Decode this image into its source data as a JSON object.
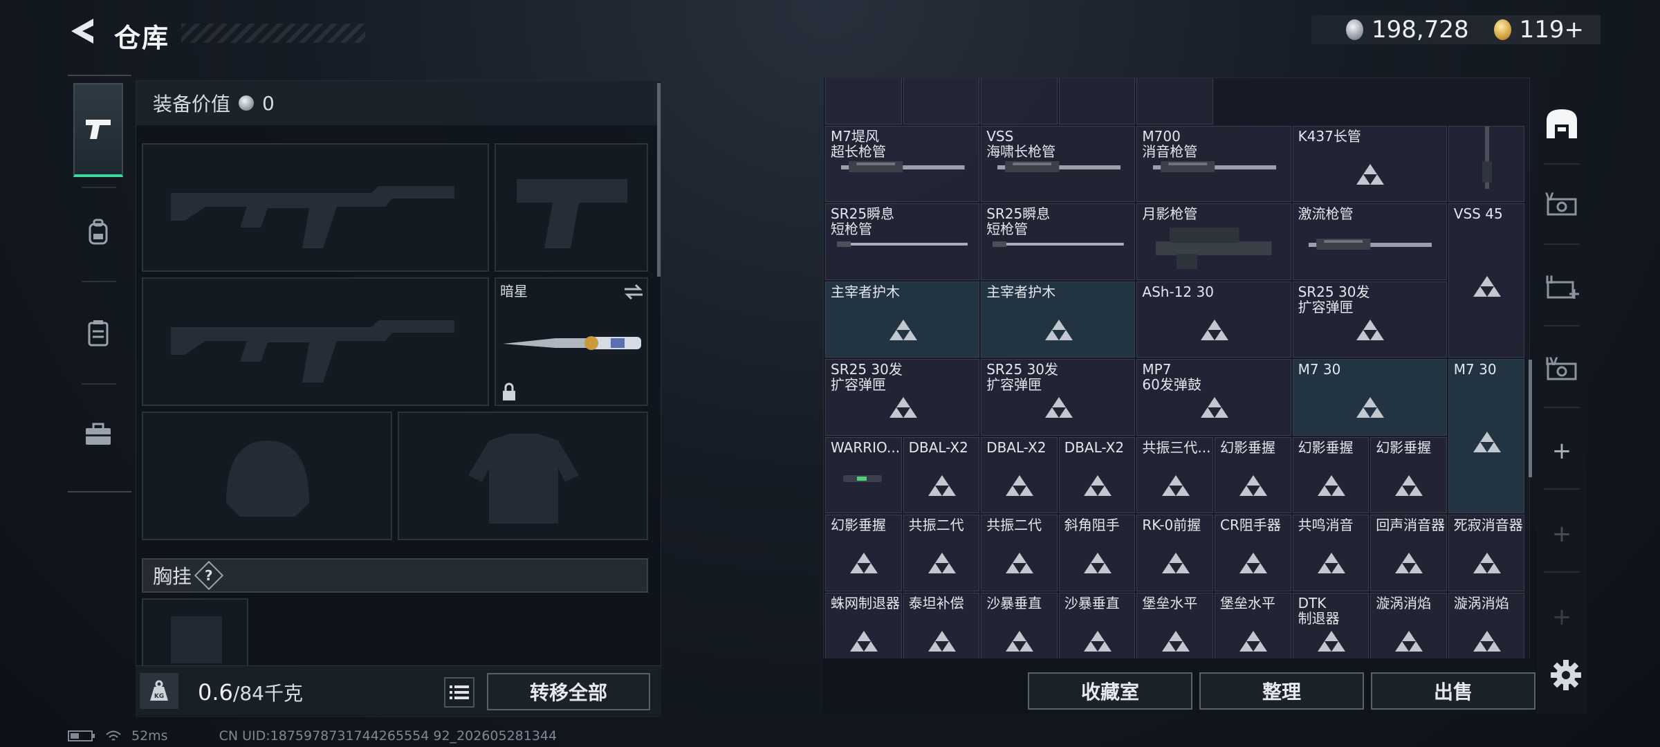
{
  "header": {
    "title": "仓库",
    "back_icon": "back-arrow-icon",
    "currencies": [
      {
        "name": "silver-coin",
        "value": "198,728",
        "color": "#c7ccd3"
      },
      {
        "name": "gold-coin",
        "value": "119+",
        "color": "#d9a53a"
      }
    ]
  },
  "left_tabs": [
    {
      "icon": "pistol-icon",
      "active": true
    },
    {
      "icon": "backpack-icon",
      "active": false
    },
    {
      "icon": "vest-icon",
      "active": false
    },
    {
      "icon": "toolbox-icon",
      "active": false
    }
  ],
  "loadout": {
    "equip_value_label": "装备价值",
    "equip_value": "0",
    "slots": [
      {
        "name": "primary-weapon-1",
        "content": "rifle-silhouette"
      },
      {
        "name": "pistol",
        "content": "pistol-silhouette"
      },
      {
        "name": "primary-weapon-2",
        "content": "rifle-silhouette"
      },
      {
        "name": "melee",
        "item_name": "暗星",
        "locked": true
      },
      {
        "name": "helmet",
        "content": "helmet-silhouette"
      },
      {
        "name": "body-armor",
        "content": "armor-silhouette"
      }
    ],
    "chest_rig_label": "胸挂",
    "chest_rig_help": "?",
    "weight_current": "0.6",
    "weight_max": "/84千克",
    "kg_icon": "weight-kg-icon",
    "transfer_all_label": "转移全部"
  },
  "inventory": {
    "rows": [
      [
        {
          "label": "",
          "w": 1,
          "art": "weapon-part"
        },
        {
          "label": "",
          "w": 1,
          "art": "weapon-part"
        },
        {
          "label": "",
          "w": 1,
          "art": "weapon-part"
        },
        {
          "label": "",
          "w": 1,
          "art": "weapon-part"
        },
        {
          "label": "",
          "w": 1,
          "art": "weapon-part"
        }
      ],
      [
        {
          "label": "M7堤风\n超长枪管",
          "w": 2,
          "art": "barrel"
        },
        {
          "label": "VSS\n海啸长枪管",
          "w": 2,
          "art": "barrel"
        },
        {
          "label": "M700\n消音枪管",
          "w": 2,
          "art": "barrel"
        },
        {
          "label": "K437长管",
          "w": 2,
          "art": "placeholder"
        },
        {
          "label": "",
          "w": 1,
          "art": "vertical-barrel"
        }
      ],
      [
        {
          "label": "SR25瞬息\n短枪管",
          "w": 2,
          "art": "thin-barrel"
        },
        {
          "label": "SR25瞬息\n短枪管",
          "w": 2,
          "art": "thin-barrel"
        },
        {
          "label": "月影枪管",
          "w": 2,
          "art": "scope-barrel"
        },
        {
          "label": "激流枪管",
          "w": 2,
          "art": "barrel"
        },
        {
          "label": "VSS 45",
          "w": 1,
          "art": "placeholder",
          "h": 2
        }
      ],
      [
        {
          "label": "主宰者护木",
          "w": 2,
          "art": "placeholder",
          "teal": true
        },
        {
          "label": "主宰者护木",
          "w": 2,
          "art": "placeholder",
          "teal": true
        },
        {
          "label": "ASh-12 30",
          "w": 2,
          "art": "placeholder"
        },
        {
          "label": "SR25 30发\n扩容弹匣",
          "w": 2,
          "art": "placeholder"
        }
      ],
      [
        {
          "label": "SR25 30发\n扩容弹匣",
          "w": 2,
          "art": "placeholder"
        },
        {
          "label": "SR25 30发\n扩容弹匣",
          "w": 2,
          "art": "placeholder"
        },
        {
          "label": "MP7\n60发弹鼓",
          "w": 2,
          "art": "placeholder"
        },
        {
          "label": "M7 30",
          "w": 2,
          "art": "placeholder",
          "teal": true
        },
        {
          "label": "M7 30",
          "w": 1,
          "art": "placeholder",
          "teal": true,
          "h": 2
        }
      ],
      [
        {
          "label": "WARRIO...",
          "w": 1,
          "art": "flashlight"
        },
        {
          "label": "DBAL-X2",
          "w": 1,
          "art": "placeholder"
        },
        {
          "label": "DBAL-X2",
          "w": 1,
          "art": "placeholder"
        },
        {
          "label": "DBAL-X2",
          "w": 1,
          "art": "placeholder"
        },
        {
          "label": "共振三代...",
          "w": 1,
          "art": "placeholder"
        },
        {
          "label": "幻影垂握",
          "w": 1,
          "art": "placeholder"
        },
        {
          "label": "幻影垂握",
          "w": 1,
          "art": "placeholder"
        },
        {
          "label": "幻影垂握",
          "w": 1,
          "art": "placeholder"
        }
      ],
      [
        {
          "label": "幻影垂握",
          "w": 1,
          "art": "placeholder"
        },
        {
          "label": "共振二代",
          "w": 1,
          "art": "placeholder"
        },
        {
          "label": "共振二代",
          "w": 1,
          "art": "placeholder"
        },
        {
          "label": "斜角阻手",
          "w": 1,
          "art": "placeholder"
        },
        {
          "label": "RK-0前握",
          "w": 1,
          "art": "placeholder"
        },
        {
          "label": "CR阻手器",
          "w": 1,
          "art": "placeholder"
        },
        {
          "label": "共鸣消音",
          "w": 1,
          "art": "placeholder"
        },
        {
          "label": "回声消音器",
          "w": 1,
          "art": "placeholder"
        },
        {
          "label": "死寂消音器",
          "w": 1,
          "art": "placeholder"
        }
      ],
      [
        {
          "label": "蛛网制退器",
          "w": 1,
          "art": "placeholder"
        },
        {
          "label": "泰坦补偿",
          "w": 1,
          "art": "placeholder"
        },
        {
          "label": "沙暴垂直",
          "w": 1,
          "art": "placeholder"
        },
        {
          "label": "沙暴垂直",
          "w": 1,
          "art": "placeholder"
        },
        {
          "label": "堡垒水平",
          "w": 1,
          "art": "placeholder"
        },
        {
          "label": "堡垒水平",
          "w": 1,
          "art": "placeholder"
        },
        {
          "label": "DTK\n制退器",
          "w": 1,
          "art": "placeholder"
        },
        {
          "label": "漩涡消焰",
          "w": 1,
          "art": "placeholder"
        },
        {
          "label": "漩涡消焰",
          "w": 1,
          "art": "placeholder"
        }
      ]
    ],
    "buttons": [
      "收藏室",
      "整理",
      "出售"
    ]
  },
  "side_nav": [
    {
      "icon": "storage-home-icon",
      "active": true
    },
    {
      "icon": "storage-v-icon"
    },
    {
      "icon": "storage-add-icon"
    },
    {
      "icon": "storage-iv-icon"
    },
    {
      "icon": "plus-icon",
      "text": "+"
    },
    {
      "icon": "plus-icon",
      "text": "+"
    },
    {
      "icon": "plus-icon",
      "text": "+"
    }
  ],
  "status_bar": {
    "ping": "52ms",
    "uid": "CN UID:1875978731744265554 92_202605281344"
  }
}
